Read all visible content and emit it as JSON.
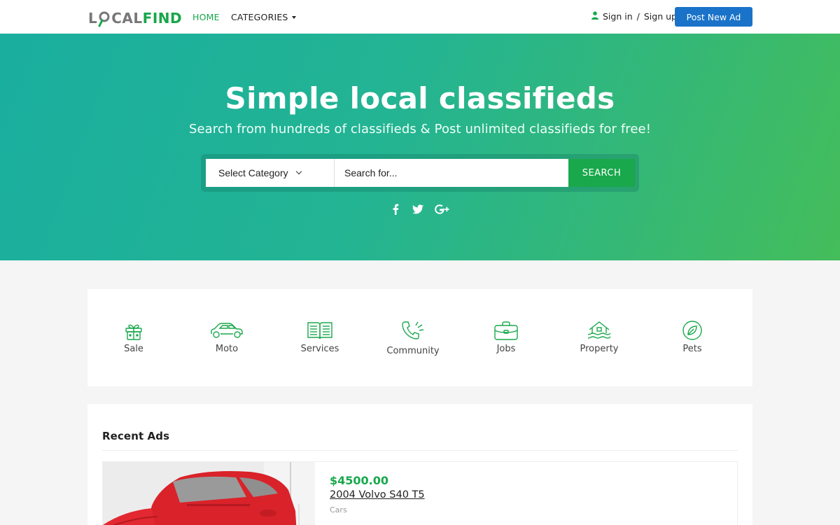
{
  "header": {
    "logo_part1": "LO",
    "logo_part2": "CAL",
    "logo_part3": "FIND",
    "nav_home": "HOME",
    "nav_categories": "CATEGORIES",
    "signin_label": "Sign in",
    "signin_separator": "/",
    "signup_label": "Sign up",
    "post_button": "Post New Ad"
  },
  "hero": {
    "title": "Simple local classifieds",
    "subtitle": "Search from hundreds of classifieds & Post unlimited classifieds for free!",
    "select_category": "Select Category",
    "search_placeholder": "Search for...",
    "search_button": "SEARCH",
    "social_icons": [
      "facebook-icon",
      "twitter-icon",
      "google-plus-icon"
    ]
  },
  "categories": [
    {
      "label": "Sale",
      "icon": "gift-icon"
    },
    {
      "label": "Moto",
      "icon": "car-icon"
    },
    {
      "label": "Services",
      "icon": "book-icon"
    },
    {
      "label": "Community",
      "icon": "phone-icon"
    },
    {
      "label": "Jobs",
      "icon": "briefcase-icon"
    },
    {
      "label": "Property",
      "icon": "house-icon"
    },
    {
      "label": "Pets",
      "icon": "leaf-icon"
    }
  ],
  "recent": {
    "title": "Recent Ads",
    "ads": [
      {
        "price": "$4500.00",
        "title": "2004 Volvo S40 T5",
        "category": "Cars"
      }
    ]
  },
  "colors": {
    "accent_green": "#19a84c",
    "primary_blue": "#1a73c9",
    "hero_gradient_start": "#1aae9f",
    "hero_gradient_end": "#44bd5a"
  }
}
